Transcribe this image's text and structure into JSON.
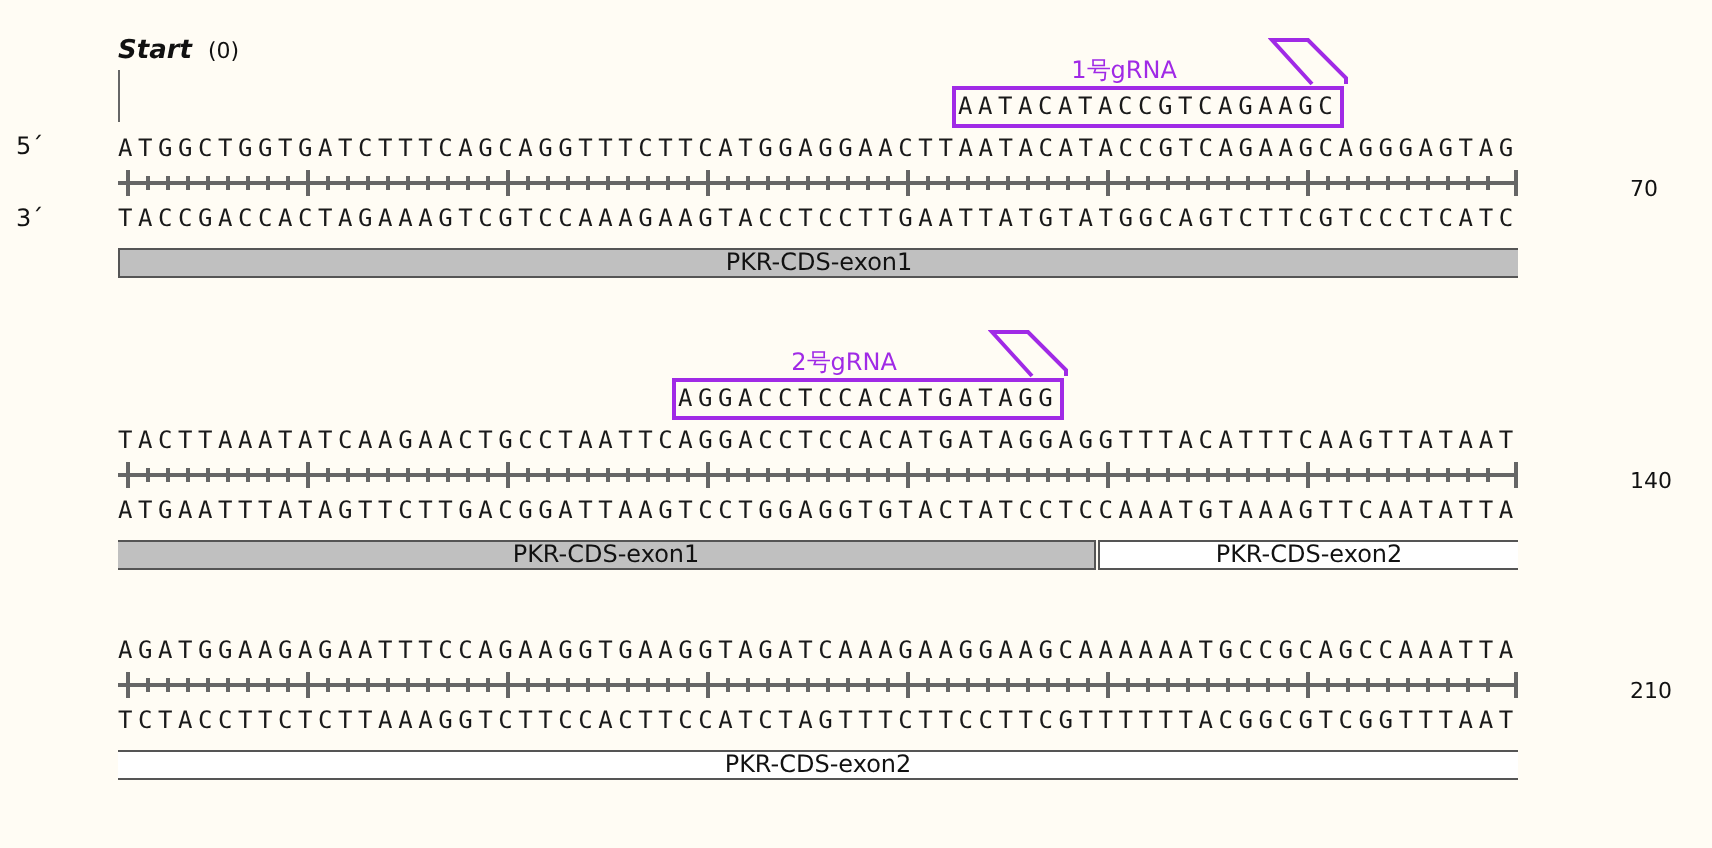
{
  "start_marker": {
    "label": "Start",
    "position": "(0)"
  },
  "strand_labels": {
    "top": "5´",
    "bottom": "3´"
  },
  "rows": [
    {
      "top": "ATGGCTGGTGATCTTTCAGCAGGTTTCTTCATGGAGGAACTTAATACATACCGTCAGAAGCAGGGAGTAG",
      "bottom": "TACCGACCACTAGAAAGTCGTCCAAAGAAGTACCTCCTTGAATTATGTATGGCAGTCTTCGTCCCTCATC",
      "end": "70",
      "grna": {
        "label": "1号gRNA",
        "sequence": "AATACATACCGTCAGAAGC"
      },
      "features": [
        {
          "label": "PKR-CDS-exon1",
          "filled": true,
          "starts_here": true,
          "ends_here": false
        }
      ]
    },
    {
      "top": "TACTTAAATATCAAGAACTGCCTAATTCAGGACCTCCACATGATAGGAGGTTTACATTTCAAGTTATAAT",
      "bottom": "ATGAATTTATAGTTCTTGACGGATTAAGTCCTGGAGGTGTACTATCCTCCAAATGTAAAGTTCAATATTA",
      "end": "140",
      "grna": {
        "label": "2号gRNA",
        "sequence": "AGGACCTCCACATGATAGG"
      },
      "features": [
        {
          "label": "PKR-CDS-exon1",
          "filled": true,
          "starts_here": false,
          "ends_here": true
        },
        {
          "label": "PKR-CDS-exon2",
          "filled": false,
          "starts_here": true,
          "ends_here": false
        }
      ]
    },
    {
      "top": "AGATGGAAGAGAATTTCCAGAAGGTGAAGGTAGATCAAAGAAGGAAGCAAAAAATGCCGCAGCCAAATTA",
      "bottom": "TCTACCTTCTCTTAAAGGTCTTCCACTTCCATCTAGTTTCTTCCTTCGTTTTTTACGGCGTCGGTTTAAT",
      "end": "210",
      "features": [
        {
          "label": "PKR-CDS-exon2",
          "filled": false,
          "starts_here": false,
          "ends_here": false
        }
      ]
    }
  ]
}
